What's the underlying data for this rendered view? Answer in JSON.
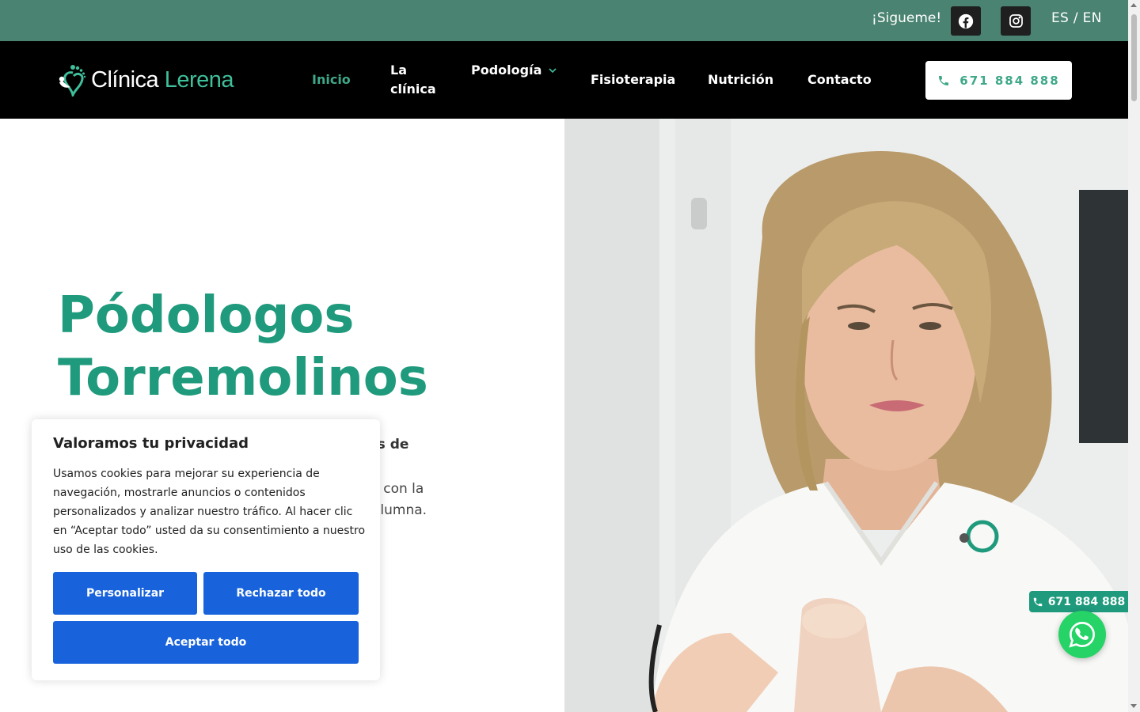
{
  "topbar": {
    "follow_label": "¡Sigueme!",
    "social": [
      {
        "name": "facebook-icon"
      },
      {
        "name": "instagram-icon"
      }
    ],
    "lang_es": "ES",
    "lang_sep": " / ",
    "lang_en": "EN",
    "bg_color": "#4a8371"
  },
  "header": {
    "logo_text_1": "Clínica",
    "logo_text_2": " Lerena",
    "nav": {
      "inicio": "Inicio",
      "clinica": "La clínica",
      "podologia": "Podología",
      "fisioterapia": "Fisioterapia",
      "nutricion": "Nutrición",
      "contacto": "Contacto"
    },
    "call_button": "671 884 888",
    "accent_color": "#3fa889"
  },
  "hero": {
    "title_line1": "Pódologos",
    "title_line2": "Torremolinos",
    "subtitle_fragment": "os de",
    "text_line1": "s con la",
    "text_line2": "olumna.",
    "title_color": "#1f9a7c"
  },
  "floating": {
    "call_label": "671 884 888",
    "whatsapp_icon": "whatsapp-icon"
  },
  "cookie_banner": {
    "title": "Valoramos tu privacidad",
    "body": "Usamos cookies para mejorar su experiencia de navegación, mostrarle anuncios o contenidos personalizados y analizar nuestro tráfico. Al hacer clic en “Aceptar todo” usted da su consentimiento a nuestro uso de las cookies.",
    "btn_personalizar": "Personalizar",
    "btn_rechazar": "Rechazar todo",
    "btn_aceptar": "Aceptar todo",
    "button_color": "#1863dc"
  }
}
